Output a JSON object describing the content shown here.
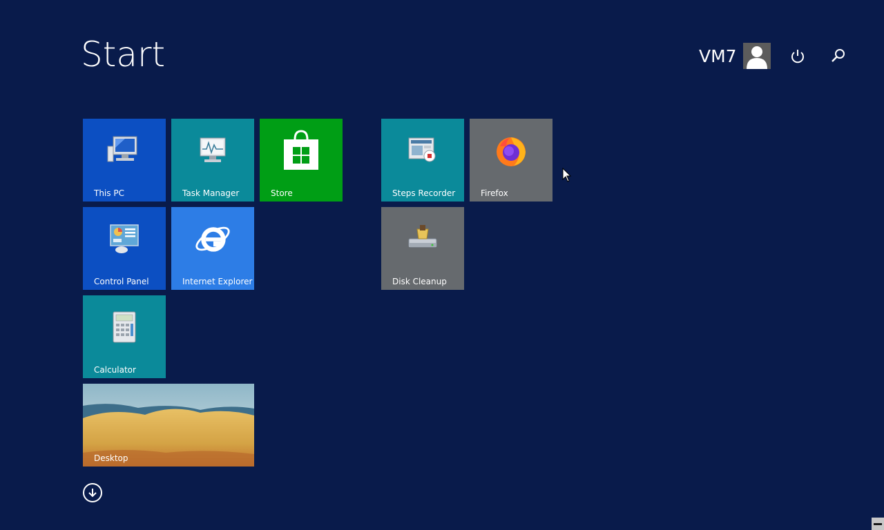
{
  "screen": {
    "title": "Start"
  },
  "user": {
    "name": "VM7"
  },
  "header_icons": {
    "power": "power-icon",
    "search": "search-icon"
  },
  "tiles": [
    {
      "label": "This PC",
      "icon": "computer-icon",
      "color": "#0c4fc2"
    },
    {
      "label": "Task Manager",
      "icon": "task-manager-icon",
      "color": "#0b8a9a"
    },
    {
      "label": "Store",
      "icon": "store-bag-icon",
      "color": "#009e15"
    },
    {
      "label": "Control Panel",
      "icon": "control-panel-icon",
      "color": "#0c4fc2"
    },
    {
      "label": "Internet Explorer",
      "icon": "internet-explorer-icon",
      "color": "#2d7de6"
    },
    {
      "label": "Calculator",
      "icon": "calculator-icon",
      "color": "#0b8a9a"
    },
    {
      "label": "Desktop",
      "icon": "desktop-wallpaper",
      "color": "#c7963a"
    },
    {
      "label": "Steps Recorder",
      "icon": "steps-recorder-icon",
      "color": "#0b8a9a"
    },
    {
      "label": "Firefox",
      "icon": "firefox-icon",
      "color": "#666a6e"
    },
    {
      "label": "Disk Cleanup",
      "icon": "disk-cleanup-icon",
      "color": "#666a6e"
    }
  ],
  "background_color": "#091b4b"
}
